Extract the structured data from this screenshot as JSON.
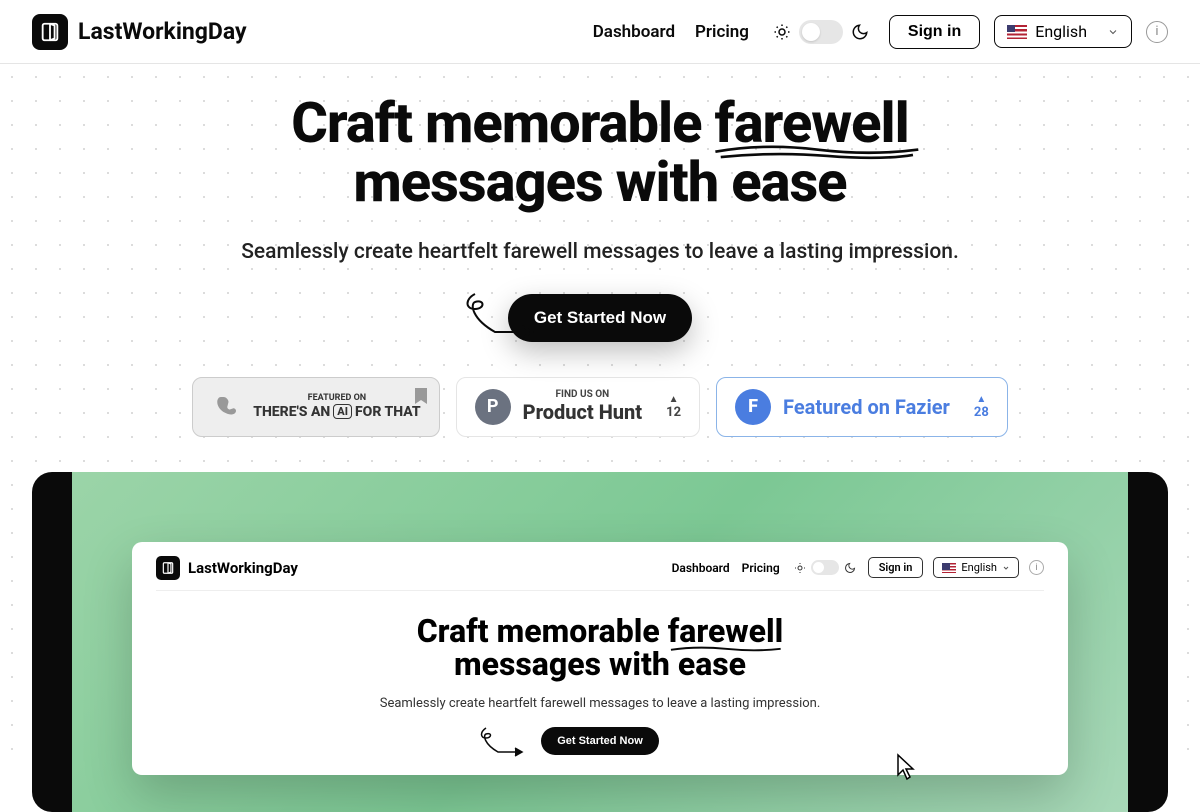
{
  "brand": "LastWorkingDay",
  "nav": {
    "dashboard": "Dashboard",
    "pricing": "Pricing"
  },
  "signin": "Sign in",
  "language": "English",
  "hero": {
    "title_part1": "Craft memorable ",
    "title_underline": "farewell",
    "title_part2": "messages with ease",
    "subtitle": "Seamlessly create heartfelt farewell messages to leave a lasting impression.",
    "cta": "Get Started Now"
  },
  "badges": {
    "taaft_top": "Featured on",
    "taaft_pre": "THERE'S AN",
    "taaft_ai": "AI",
    "taaft_post": "FOR THAT",
    "ph_top": "FIND US ON",
    "ph_main": "Product Hunt",
    "ph_votes": "12",
    "fazier_text": "Featured on Fazier",
    "fazier_votes": "28"
  },
  "demo": {
    "brand": "LastWorkingDay",
    "dashboard": "Dashboard",
    "pricing": "Pricing",
    "signin": "Sign in",
    "language": "English",
    "title_part1": "Craft memorable ",
    "title_underline": "farewell",
    "title_part2": "messages with ease",
    "subtitle": "Seamlessly create heartfelt farewell messages to leave a lasting impression.",
    "cta": "Get Started Now"
  }
}
